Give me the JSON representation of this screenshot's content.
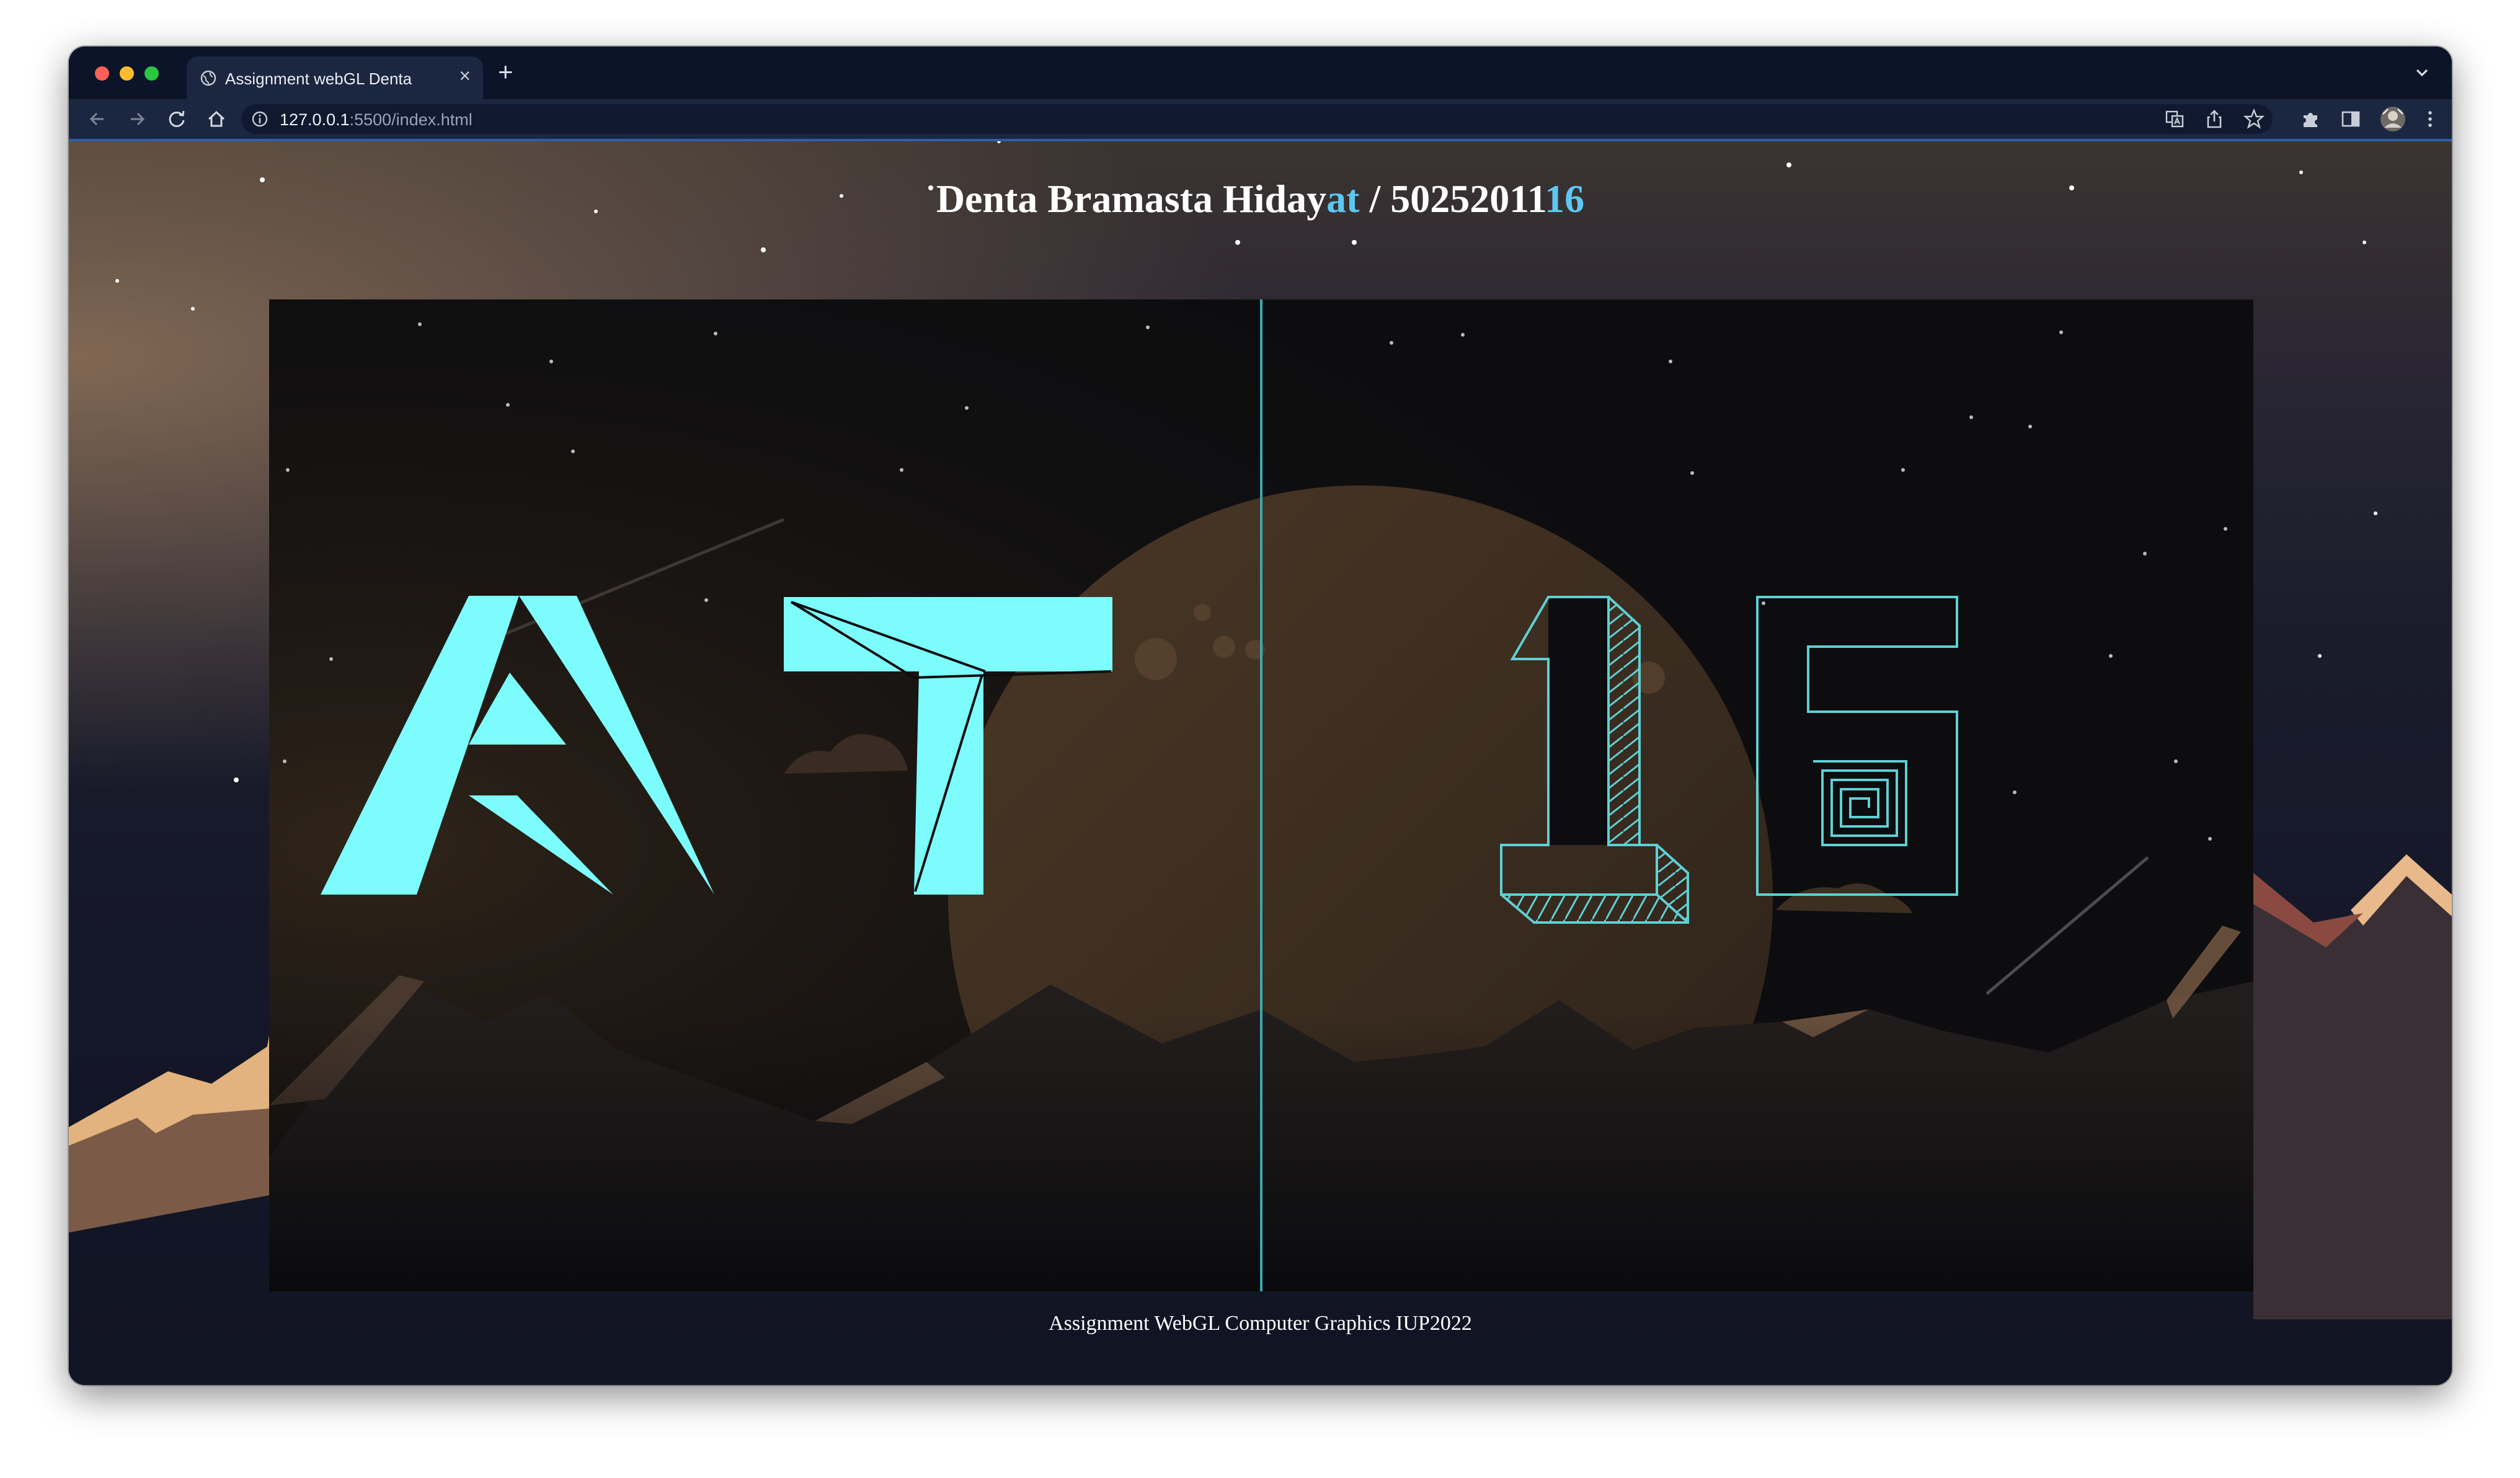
{
  "browser": {
    "tab_title": "Assignment webGL Denta",
    "new_tab_symbol": "+",
    "close_symbol": "×",
    "url_host": "127.0.0.1",
    "url_path": ":5500/index.html"
  },
  "page": {
    "title_name": "Denta Bramasta Hiday",
    "title_name_accent": "at",
    "title_separator": " / ",
    "title_id": "50252011",
    "title_id_accent": "16",
    "footer": "Assignment WebGL Computer Graphics IUP2022"
  },
  "colors": {
    "accent_text": "#5cc8f2",
    "glyph_fill": "#7dfcfd",
    "glyph_stroke": "#5ed0d4",
    "divider": "#3aa9b0",
    "canvas_bg": "#0d0d0f",
    "moon": "#3a2d22"
  },
  "icons": {
    "back": "arrow-left-icon",
    "forward": "arrow-right-icon",
    "reload": "reload-icon",
    "home": "home-icon",
    "info": "info-icon",
    "translate": "translate-icon",
    "share": "share-icon",
    "bookmark": "star-icon",
    "extensions": "puzzle-icon",
    "side_panel": "side-panel-icon",
    "profile": "avatar",
    "menu": "kebab-menu-icon"
  }
}
